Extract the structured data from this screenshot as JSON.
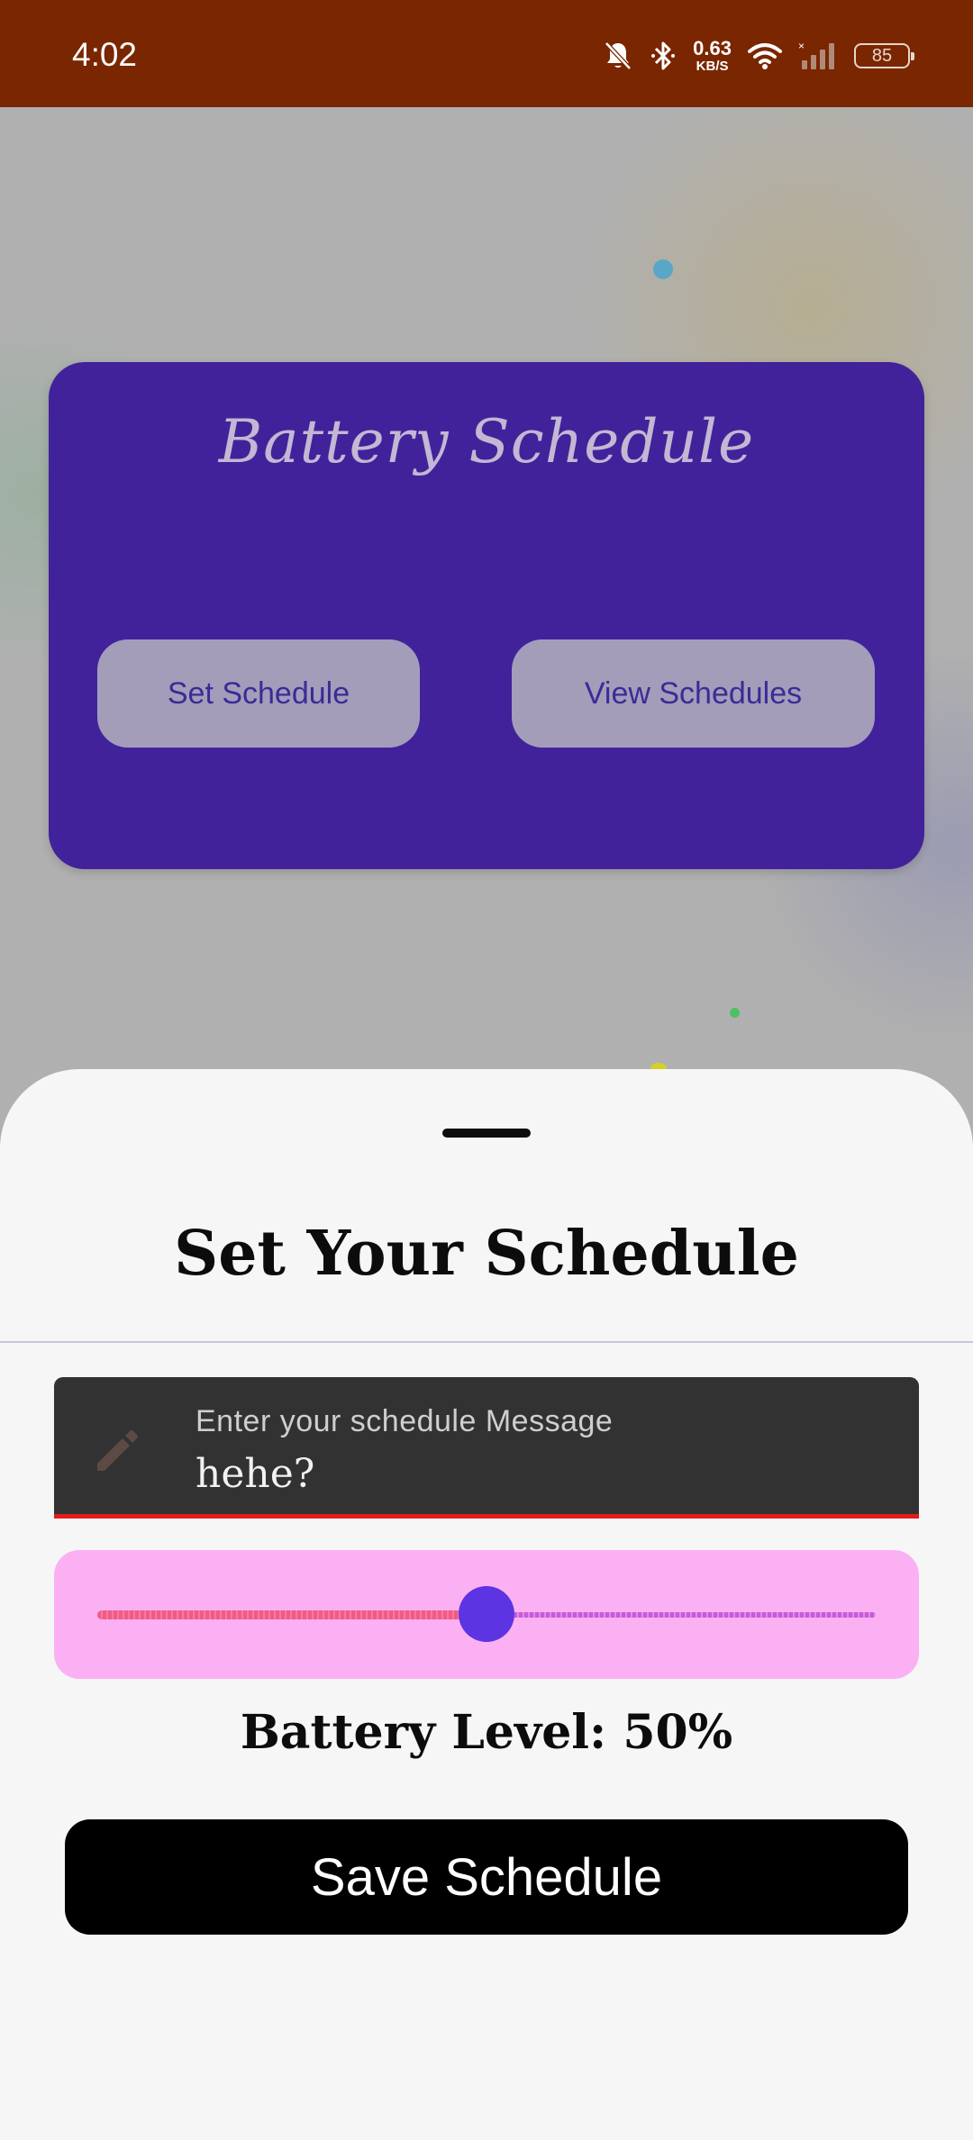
{
  "status_bar": {
    "time": "4:02",
    "net_speed_value": "0.63",
    "net_speed_unit": "KB/S",
    "battery_level": "85",
    "icons": [
      "bell-off-icon",
      "bluetooth-icon",
      "wifi-icon",
      "signal-icon",
      "battery-icon"
    ],
    "background_color": "#7a2600"
  },
  "card": {
    "title": "Battery Schedule",
    "set_schedule_label": "Set Schedule",
    "view_schedules_label": "View Schedules",
    "background_color": "#42229b"
  },
  "sheet": {
    "title": "Set Your Schedule",
    "message_field": {
      "label": "Enter your schedule Message",
      "value": "hehe?",
      "icon": "pencil-icon"
    },
    "slider": {
      "value": 50,
      "min": 0,
      "max": 100,
      "thumb_color": "#5d34e2",
      "background_color": "#fbb0f3"
    },
    "battery_level_text": "Battery Level: 50%",
    "save_label": "Save Schedule"
  }
}
